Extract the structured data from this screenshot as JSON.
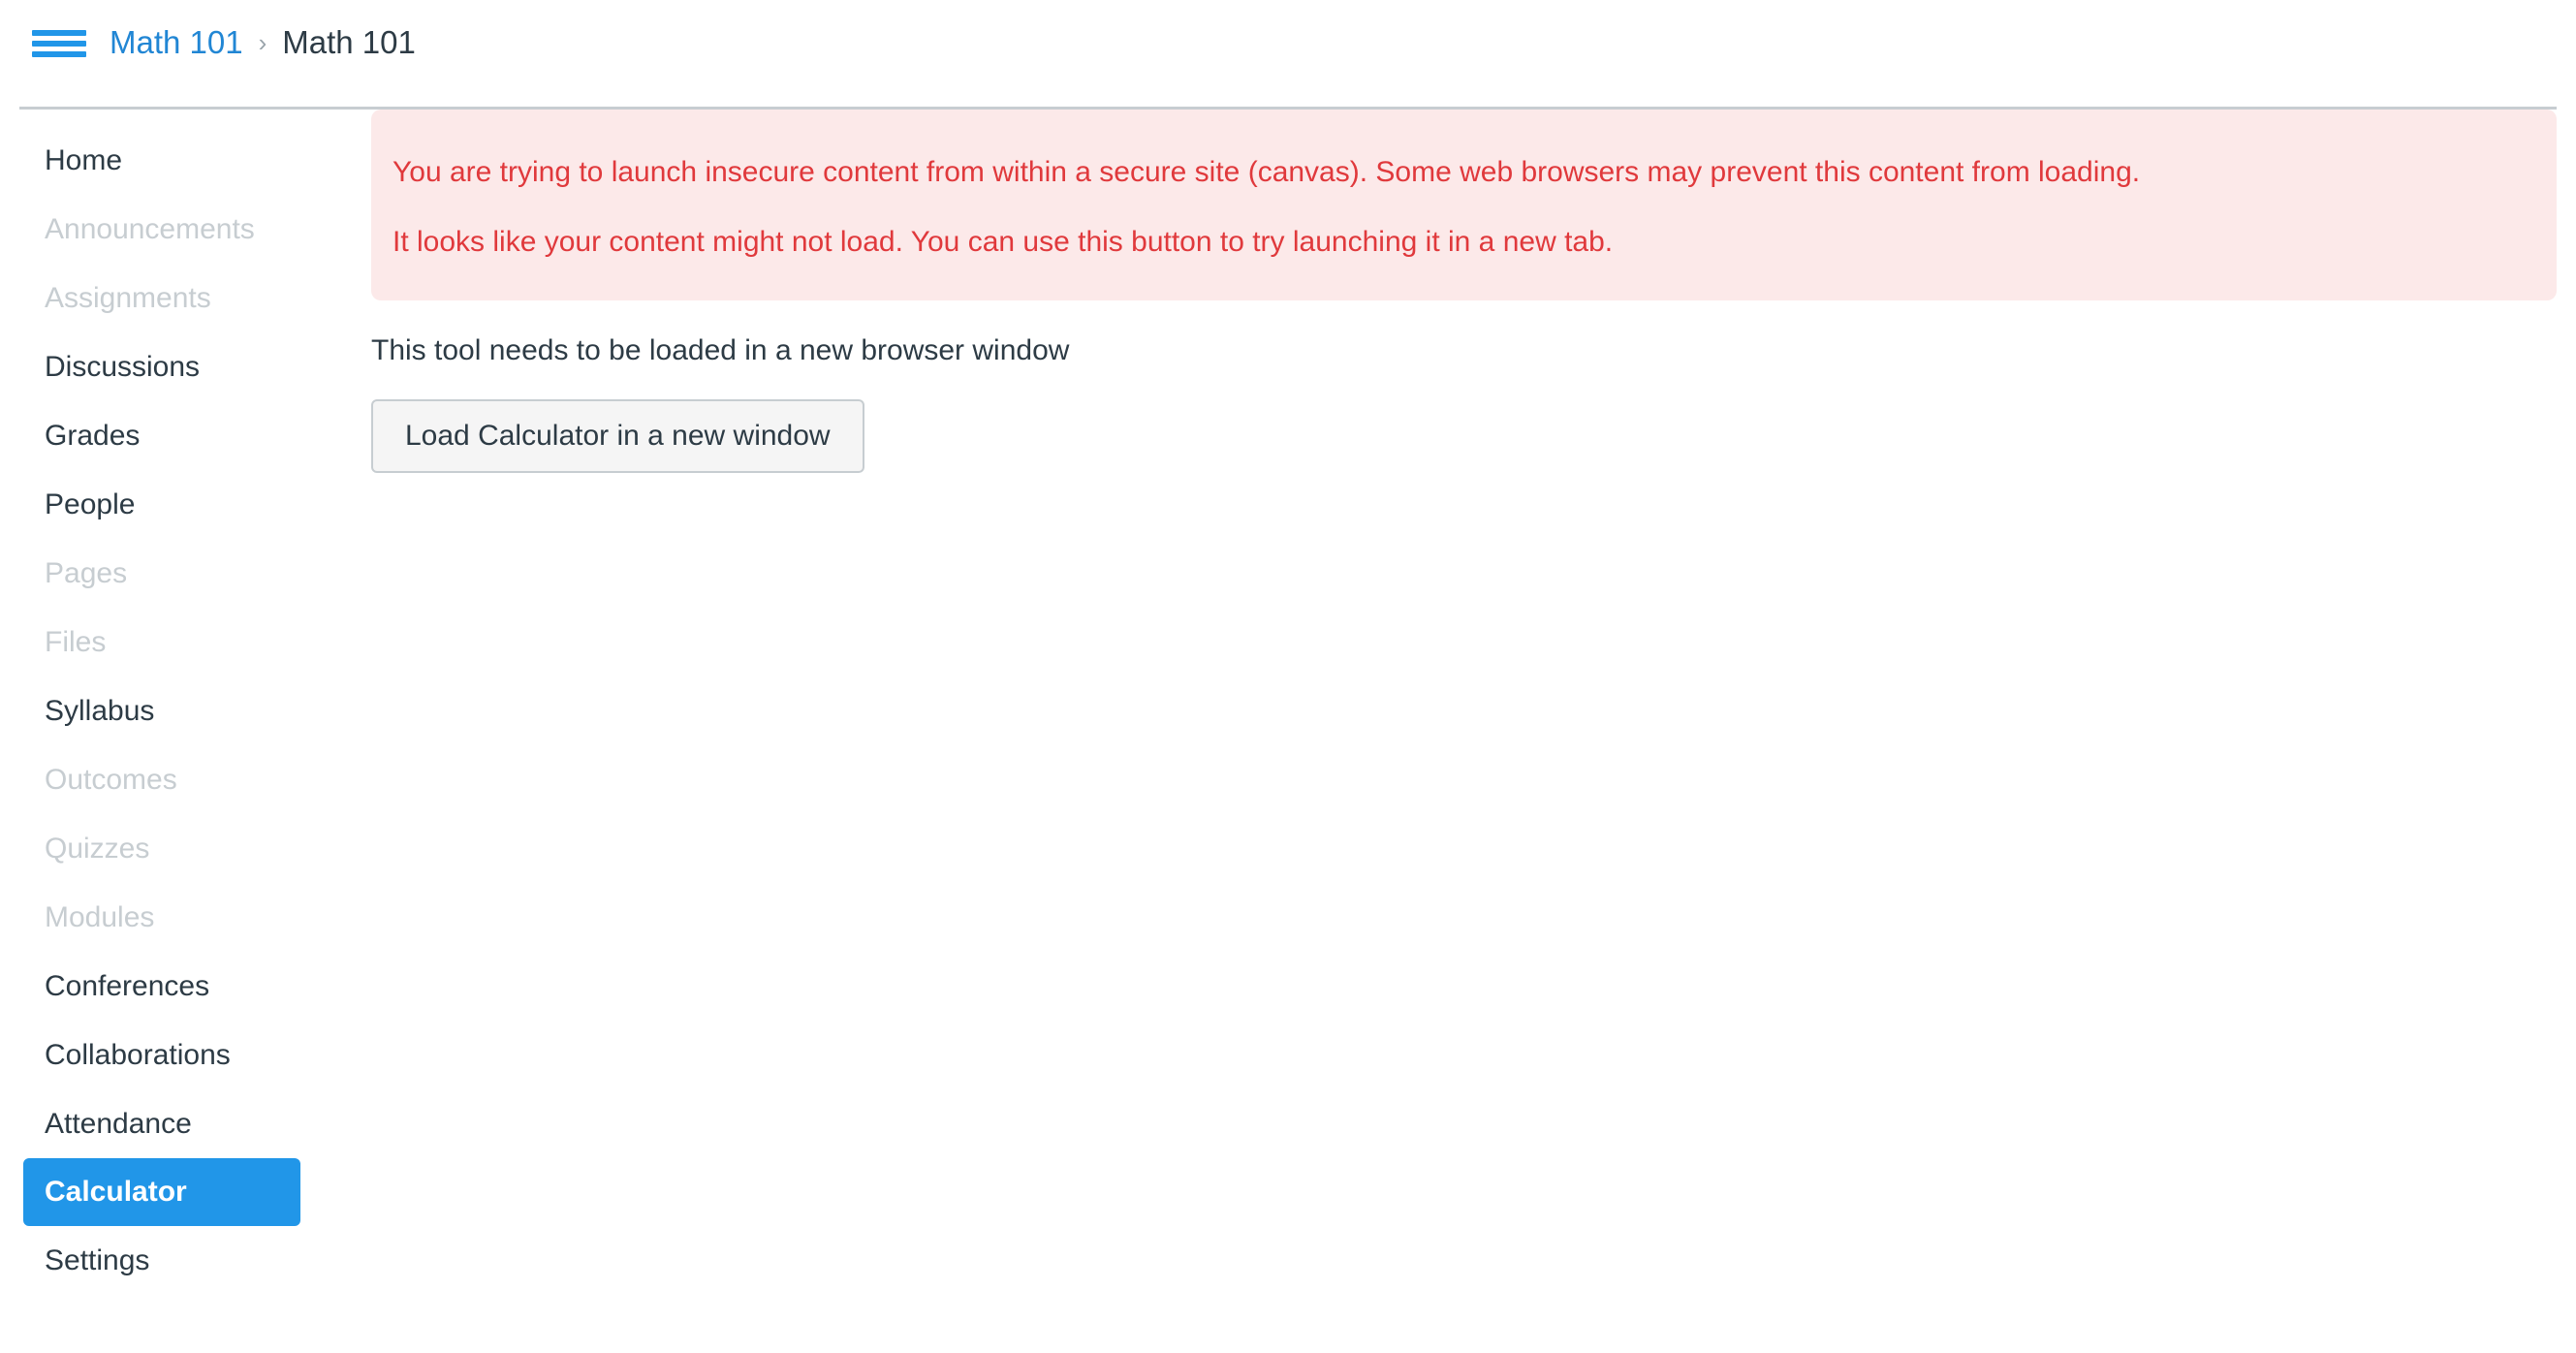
{
  "header": {
    "menu_icon": "hamburger-menu-icon",
    "breadcrumb": {
      "course_link": "Math 101",
      "separator": "›",
      "current": "Math 101"
    }
  },
  "sidebar": {
    "items": [
      {
        "label": "Home",
        "state": "enabled"
      },
      {
        "label": "Announcements",
        "state": "disabled"
      },
      {
        "label": "Assignments",
        "state": "disabled"
      },
      {
        "label": "Discussions",
        "state": "enabled"
      },
      {
        "label": "Grades",
        "state": "enabled"
      },
      {
        "label": "People",
        "state": "enabled"
      },
      {
        "label": "Pages",
        "state": "disabled"
      },
      {
        "label": "Files",
        "state": "disabled"
      },
      {
        "label": "Syllabus",
        "state": "enabled"
      },
      {
        "label": "Outcomes",
        "state": "disabled"
      },
      {
        "label": "Quizzes",
        "state": "disabled"
      },
      {
        "label": "Modules",
        "state": "disabled"
      },
      {
        "label": "Conferences",
        "state": "enabled"
      },
      {
        "label": "Collaborations",
        "state": "enabled"
      },
      {
        "label": "Attendance",
        "state": "enabled"
      },
      {
        "label": "Calculator",
        "state": "active"
      },
      {
        "label": "Settings",
        "state": "enabled"
      }
    ]
  },
  "main": {
    "alert": {
      "line1": "You are trying to launch insecure content from within a secure site (canvas). Some web browsers may prevent this content from loading.",
      "line2": "It looks like your content might not load. You can use this button to try launching it in a new tab."
    },
    "tool_message": "This tool needs to be loaded in a new browser window",
    "launch_button": "Load Calculator in a new window"
  },
  "colors": {
    "link_blue": "#2186d4",
    "accent_blue": "#2196e8",
    "error_red": "#e0393c",
    "alert_bg": "#fce9e9",
    "text_dark": "#2d3b45",
    "text_disabled": "#c7cdd1",
    "border_grey": "#c7cdd1",
    "button_bg": "#f5f5f5"
  }
}
